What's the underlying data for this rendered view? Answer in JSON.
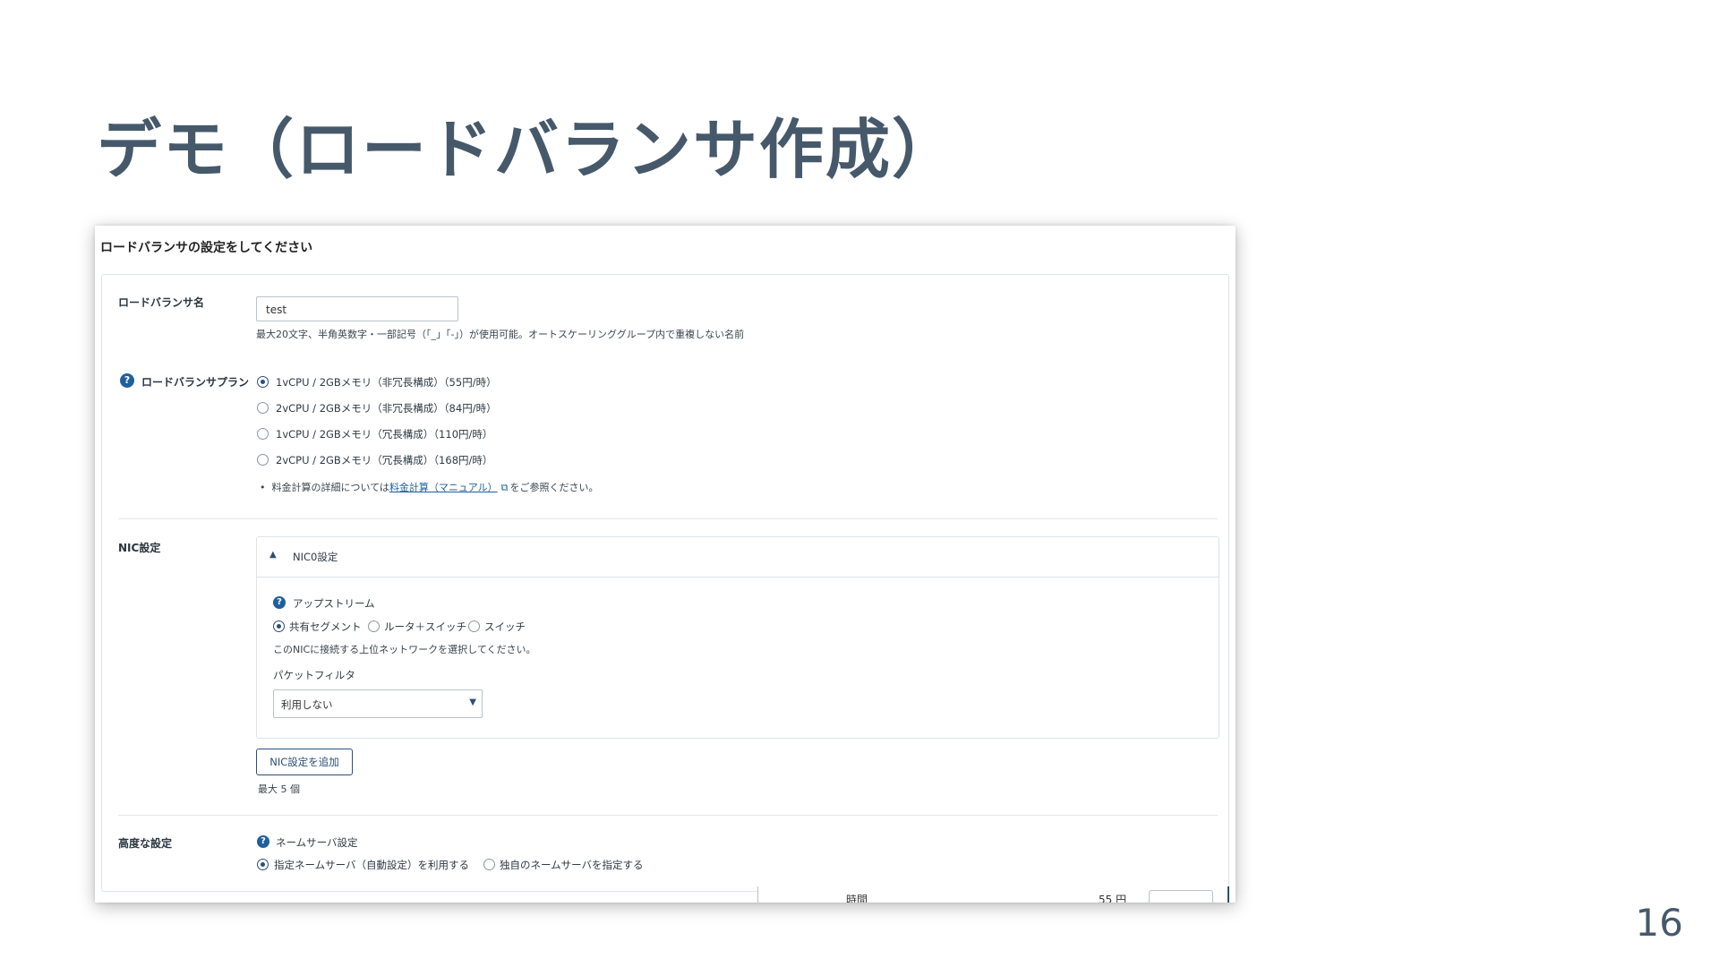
{
  "slide": {
    "title": "デモ（ロードバランサ作成）",
    "page_number": "16"
  },
  "form": {
    "heading": "ロードバランサの設定をしてください",
    "name": {
      "label": "ロードバランサ名",
      "value": "test",
      "hint": "最大20文字、半角英数字・一部記号（「_」「-」）が使用可能。オートスケーリンググループ内で重複しない名前"
    },
    "plan": {
      "label": "ロードバランサプラン",
      "help_icon": "question-circle-icon",
      "options": [
        {
          "label": "1vCPU / 2GBメモリ（非冗長構成）（55円/時）",
          "checked": true
        },
        {
          "label": "2vCPU / 2GBメモリ（非冗長構成）（84円/時）",
          "checked": false
        },
        {
          "label": "1vCPU / 2GBメモリ（冗長構成）（110円/時）",
          "checked": false
        },
        {
          "label": "2vCPU / 2GBメモリ（冗長構成）（168円/時）",
          "checked": false
        }
      ],
      "pricing_note_prefix": "料金計算の詳細については",
      "pricing_link": "料金計算（マニュアル）",
      "pricing_note_suffix": "をご参照ください。"
    },
    "nic": {
      "label": "NIC設定",
      "section_title": "NIC0設定",
      "upstream_label": "アップストリーム",
      "upstream_options": [
        {
          "label": "共有セグメント",
          "checked": true
        },
        {
          "label": "ルータ＋スイッチ",
          "checked": false
        },
        {
          "label": "スイッチ",
          "checked": false
        }
      ],
      "upstream_hint": "このNICに接続する上位ネットワークを選択してください。",
      "packet_filter_label": "パケットフィルタ",
      "packet_filter_value": "利用しない",
      "add_button": "NIC設定を追加",
      "max_note": "最大 5 個"
    },
    "advanced": {
      "label": "高度な設定",
      "nameserver_label": "ネームサーバ設定",
      "nameserver_options": [
        {
          "label": "指定ネームサーバ（自動設定）を利用する",
          "checked": true
        },
        {
          "label": "独自のネームサーバを指定する",
          "checked": false
        }
      ]
    },
    "footer": {
      "label": "時間",
      "price": "55 円"
    }
  },
  "colors": {
    "title": "#46596a",
    "accent": "#2a4f7a",
    "link": "#1f5f9f"
  }
}
